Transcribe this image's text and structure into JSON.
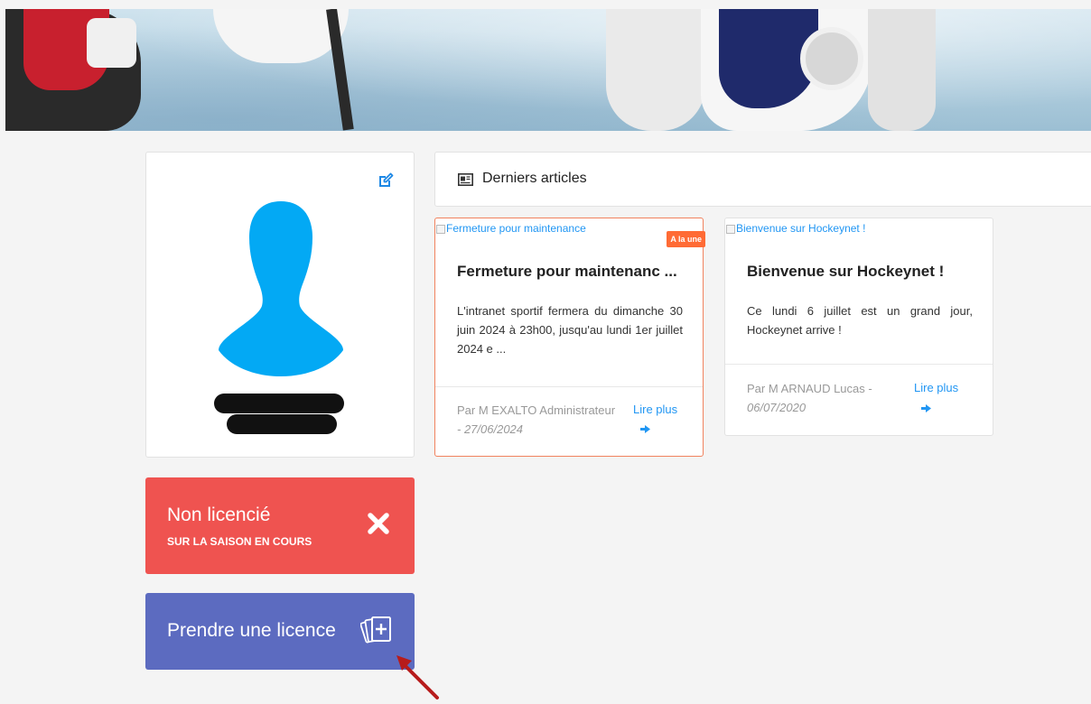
{
  "profile": {
    "edit_icon": "edit-icon",
    "avatar_icon": "user-silhouette-icon",
    "accent": "#03a9f4"
  },
  "status": {
    "title": "Non licencié",
    "subtitle": "SUR LA SAISON EN COURS",
    "icon": "close-icon",
    "color": "#ef5350"
  },
  "licence": {
    "label": "Prendre une licence",
    "icon": "cards-plus-icon",
    "color": "#5c6bc0"
  },
  "articles": {
    "header": "Derniers articles",
    "header_icon": "newspaper-icon",
    "items": [
      {
        "image_alt": "Fermeture pour maintenance",
        "badge": "A la une",
        "title": "Fermeture pour maintenanc ...",
        "excerpt": "L'intranet sportif fermera du dimanche 30 juin 2024 à 23h00, jusqu'au lundi 1er juillet 2024 e ...",
        "author": "Par M EXALTO Administrateur",
        "date": "- 27/06/2024",
        "read_more": "Lire plus"
      },
      {
        "image_alt": "Bienvenue sur Hockeynet !",
        "title": "Bienvenue sur Hockeynet !",
        "excerpt": "Ce lundi 6 juillet est un grand jour, Hockeynet arrive !",
        "author": "Par M ARNAUD Lucas -",
        "date": "06/07/2020",
        "read_more": "Lire plus"
      }
    ]
  }
}
